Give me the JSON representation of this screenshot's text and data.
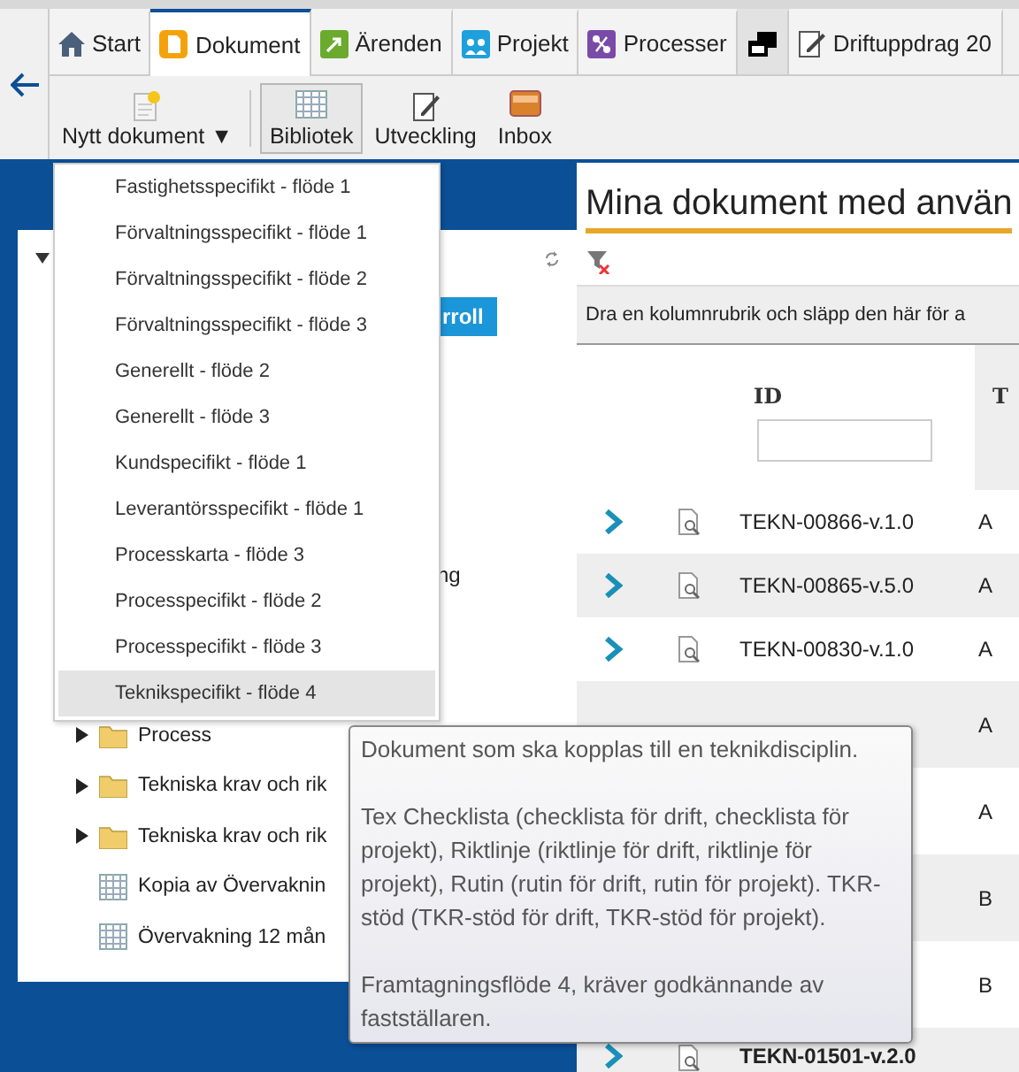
{
  "tabs": [
    {
      "label": "Start",
      "kind": "home",
      "selected": false
    },
    {
      "label": "Dokument",
      "kind": "document",
      "selected": true
    },
    {
      "label": "Ärenden",
      "kind": "case",
      "selected": false
    },
    {
      "label": "Projekt",
      "kind": "project",
      "selected": false
    },
    {
      "label": "Processer",
      "kind": "process",
      "selected": false
    },
    {
      "kind": "windows",
      "selected": false
    },
    {
      "label": "Driftuppdrag 20",
      "kind": "edit",
      "selected": false
    }
  ],
  "toolbar": [
    {
      "label": "Nytt dokument",
      "caret": "▼",
      "kind": "new",
      "selected": false
    },
    {
      "label": "Bibliotek",
      "kind": "library",
      "selected": true
    },
    {
      "label": "Utveckling",
      "kind": "develop",
      "selected": false
    },
    {
      "label": "Inbox",
      "kind": "inbox",
      "selected": false
    }
  ],
  "menu": {
    "items": [
      {
        "label": "Fastighetsspecifikt - flöde 1",
        "selected": false
      },
      {
        "label": "Förvaltningsspecifikt - flöde 1",
        "selected": false
      },
      {
        "label": "Förvaltningsspecifikt - flöde 2",
        "selected": false
      },
      {
        "label": "Förvaltningsspecifikt - flöde 3",
        "selected": false
      },
      {
        "label": "Generellt - flöde 2",
        "selected": false
      },
      {
        "label": "Generellt - flöde 3",
        "selected": false
      },
      {
        "label": "Kundspecifikt - flöde 1",
        "selected": false
      },
      {
        "label": "Leverantörsspecifikt - flöde 1",
        "selected": false
      },
      {
        "label": "Processkarta - flöde 3",
        "selected": false
      },
      {
        "label": "Processpecifikt - flöde 2",
        "selected": false
      },
      {
        "label": "Processpecifikt - flöde 3",
        "selected": false
      },
      {
        "label": "Teknikspecifikt - flöde 4",
        "selected": true
      }
    ]
  },
  "tree": {
    "button": "rroll",
    "fragment": "ng",
    "items": [
      {
        "label": "Process",
        "kind": "folder"
      },
      {
        "label": "Tekniska krav och rik",
        "kind": "folder"
      },
      {
        "label": "Tekniska krav och rik",
        "kind": "folder"
      },
      {
        "label": "Kopia av Övervaknin",
        "kind": "grid"
      },
      {
        "label": "Övervakning 12 mån",
        "kind": "grid"
      }
    ]
  },
  "grid": {
    "title": "Mina dokument med använ",
    "group_hint": "Dra en kolumnrubrik och släpp den här för a",
    "columns": [
      "ID",
      "T"
    ],
    "rows": [
      {
        "kind": "full",
        "id": "TEKN-00866-v.1.0",
        "column_3": "A"
      },
      {
        "kind": "full",
        "id": "TEKN-00865-v.5.0",
        "column_3": "A"
      },
      {
        "kind": "full",
        "id": "TEKN-00830-v.1.0",
        "column_3": "A"
      },
      {
        "kind": "covered",
        "column_3": "A"
      },
      {
        "kind": "covered",
        "column_3": "A"
      },
      {
        "kind": "covered",
        "column_3": "B"
      },
      {
        "kind": "covered",
        "column_3": "B"
      },
      {
        "kind": "bold",
        "id": "TEKN-01501-v.2.0"
      }
    ]
  },
  "tooltip": {
    "paragraphs": [
      "Dokument som ska kopplas till en teknikdisciplin.",
      "Tex Checklista (checklista för drift, checklista för projekt), Riktlinje (riktlinje för drift, riktlinje för projekt), Rutin (rutin för drift, rutin för projekt). TKR-stöd (TKR-stöd för drift, TKR-stöd för projekt).",
      "Framtagningsflöde 4, kräver godkännande av fastställaren."
    ]
  }
}
